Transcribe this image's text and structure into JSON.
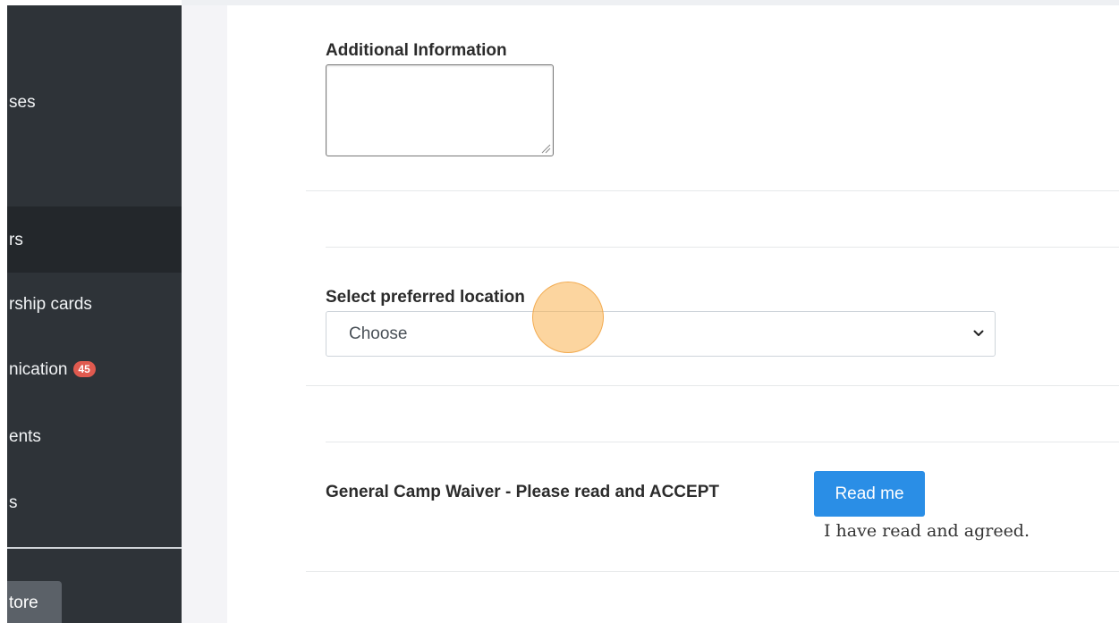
{
  "sidebar": {
    "items": [
      {
        "label": "ses"
      },
      {
        "label": "rs"
      },
      {
        "label": "rship cards"
      },
      {
        "label": "nication",
        "badge": "45"
      },
      {
        "label": "ents"
      },
      {
        "label": "s"
      }
    ],
    "store_label": "tore"
  },
  "form": {
    "additional_info_label": "Additional Information",
    "additional_info_value": "",
    "location_label": "Select preferred location",
    "location_selected": "Choose",
    "waiver_label": "General Camp Waiver - Please read and ACCEPT",
    "read_button_label": "Read me",
    "agreed_text": "I have read and agreed."
  },
  "colors": {
    "sidebar_bg": "#2e3338",
    "badge": "#e05a4f",
    "primary_button": "#2a8ee6",
    "cursor_highlight": "#fab250"
  }
}
